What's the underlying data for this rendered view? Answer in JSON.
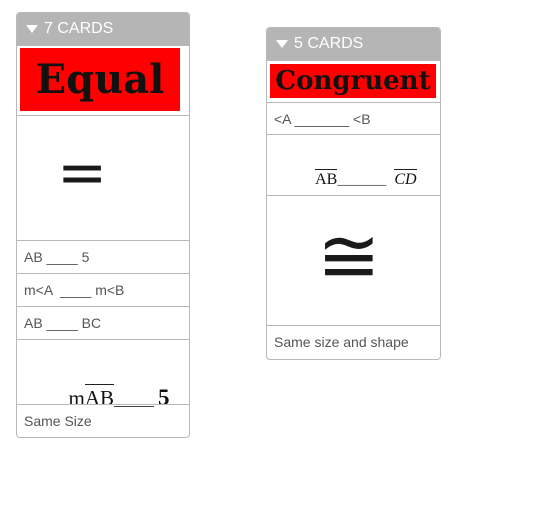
{
  "stacks": [
    {
      "header": "7 CARDS",
      "banner": "Equal",
      "cards": {
        "equals_symbol": "=",
        "ab_5": "AB ____ 5",
        "ma_mb": "m<A  ____ m<B",
        "ab_bc": "AB ____ BC",
        "m_ab_5": {
          "m": "m",
          "ab": "AB",
          "blank": "_____",
          "five": "5"
        },
        "definition": "Same Size"
      }
    },
    {
      "header": "5 CARDS",
      "banner": "Congruent",
      "cards": {
        "angle_a_b": "<A _______ <B",
        "ab_cd": {
          "ab": "AB",
          "blank": "_______",
          "cd": "CD"
        },
        "congruent_symbol": "≅",
        "definition": "Same size and shape"
      }
    }
  ],
  "colors": {
    "header_bg": "#b5b5b5",
    "banner_bg": "#ff0000",
    "border": "#b8b8b8",
    "text": "#555555"
  },
  "icons": {
    "collapse": "caret-down-icon"
  }
}
